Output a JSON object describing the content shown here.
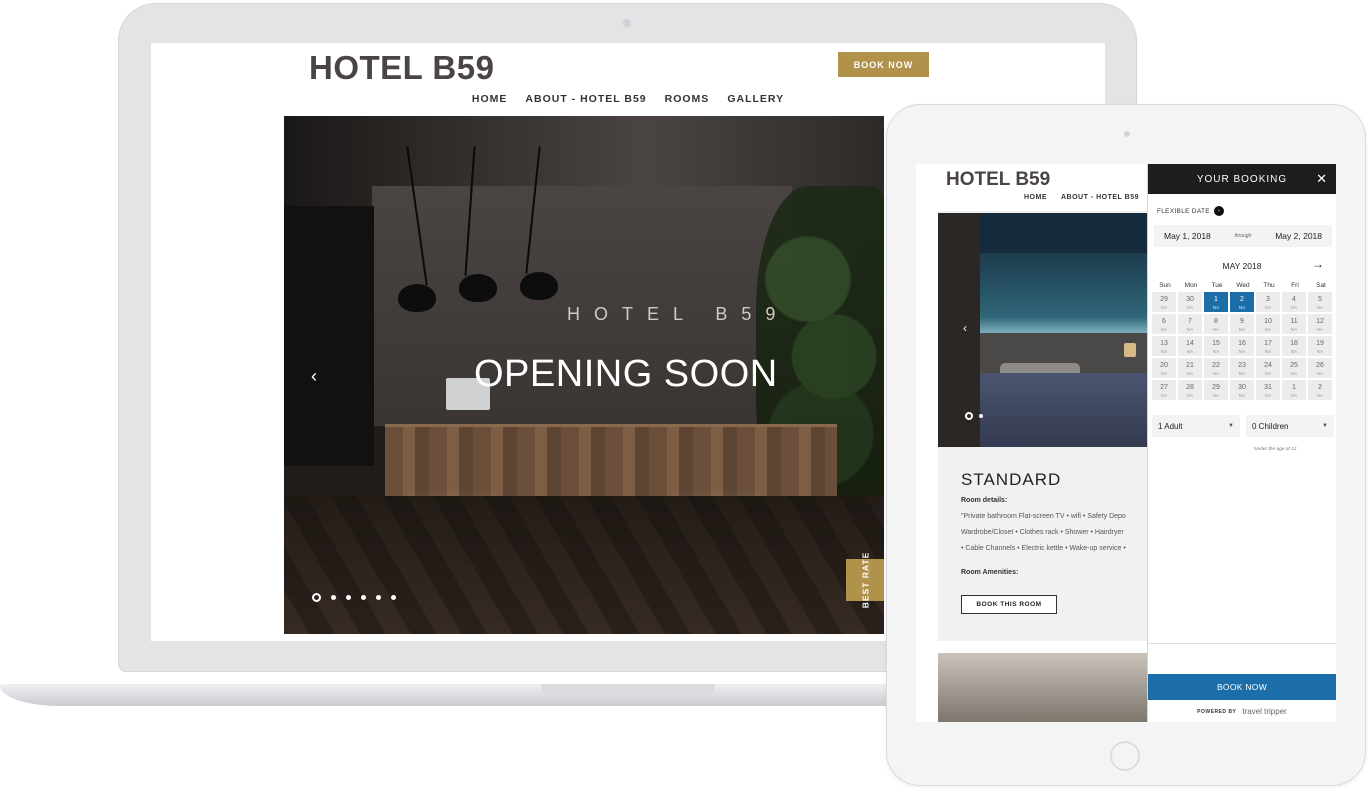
{
  "laptop_site": {
    "logo": "HOTEL B59",
    "book_now": "BOOK NOW",
    "nav": [
      "HOME",
      "ABOUT - HOTEL B59",
      "ROOMS",
      "GALLERY"
    ],
    "active_nav": "HOME",
    "hero": {
      "subtitle": "HOTEL B59",
      "title": "OPENING SOON",
      "prev_glyph": "‹",
      "slide_count": 6,
      "active_slide": 1
    },
    "best_rate": "BEST RATE"
  },
  "tablet_site": {
    "logo": "HOTEL B59",
    "nav": [
      "HOME",
      "ABOUT - HOTEL B59"
    ],
    "room": {
      "title": "STANDARD",
      "details_label": "Room details:",
      "details_lines": [
        "\"Private bathroom Flat-screen TV • wifi • Safety Depo",
        "Wardrobe/Closet • Clothes rack • Shower • Hairdryer",
        "• Cable Channels • Electric kettle • Wake-up service •"
      ],
      "amenities_label": "Room Amenities:",
      "book_button": "BOOK THIS ROOM"
    }
  },
  "booking_panel": {
    "title": "YOUR BOOKING",
    "close_glyph": "✕",
    "flexible_label": "FLEXIBLE DATE",
    "check_in": "May 1, 2018",
    "through": "through",
    "check_out": "May 2, 2018",
    "month": "MAY 2018",
    "next_glyph": "→",
    "weekdays": [
      "Sun",
      "Mon",
      "Tue",
      "Wed",
      "Thu",
      "Fri",
      "Sat"
    ],
    "weeks": [
      [
        "29",
        "30",
        "1",
        "2",
        "3",
        "4",
        "5"
      ],
      [
        "6",
        "7",
        "8",
        "9",
        "10",
        "11",
        "12"
      ],
      [
        "13",
        "14",
        "15",
        "16",
        "17",
        "18",
        "19"
      ],
      [
        "20",
        "21",
        "22",
        "23",
        "24",
        "25",
        "26"
      ],
      [
        "27",
        "28",
        "29",
        "30",
        "31",
        "1",
        "2"
      ]
    ],
    "cell_rate": "NA",
    "arrival_tag": "ARRIVAL",
    "departure_tag": "DEPARTURE",
    "selected_days": [
      "1",
      "2"
    ],
    "adults": "1 Adult",
    "children": "0 Children",
    "children_note": "*under the age of 12",
    "book_now": "BOOK NOW",
    "powered_by": "POWERED BY",
    "powered_brand": "travel tripper"
  },
  "colors": {
    "gold": "#b0924b",
    "booking_blue": "#1b6ea8",
    "panel_header": "#1d1d1d"
  }
}
